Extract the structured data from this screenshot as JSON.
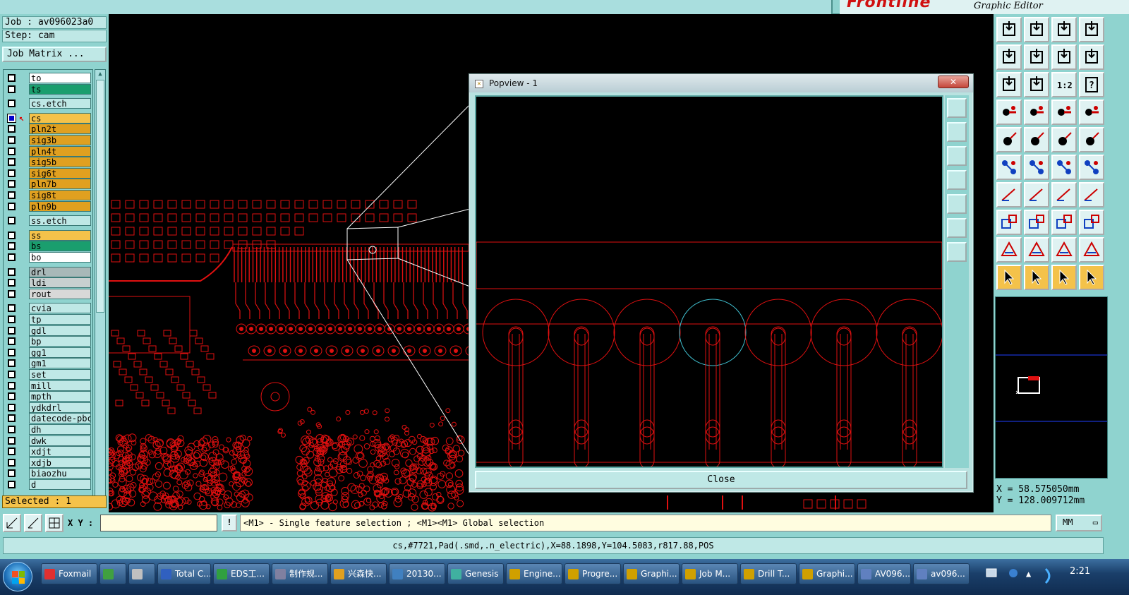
{
  "brand": {
    "logo": "Frontline",
    "caption": "Graphic Editor"
  },
  "job": {
    "job_line": "Job : av096023a0",
    "step_line": "Step: cam",
    "matrix_button": "Job Matrix ..."
  },
  "layers": [
    {
      "name": "to",
      "color": "#ffffff",
      "group": 0
    },
    {
      "name": "ts",
      "color": "#1a9e6e",
      "group": 0
    },
    {
      "name": "cs.etch",
      "color": "#bfe8e6",
      "group": 1
    },
    {
      "name": "cs",
      "color": "#f4c24a",
      "group": 2,
      "active": true
    },
    {
      "name": "pln2t",
      "color": "#e0a020",
      "group": 2
    },
    {
      "name": "sig3b",
      "color": "#e0a020",
      "group": 2
    },
    {
      "name": "pln4t",
      "color": "#e0a020",
      "group": 2
    },
    {
      "name": "sig5b",
      "color": "#e0a020",
      "group": 2
    },
    {
      "name": "sig6t",
      "color": "#e0a020",
      "group": 2
    },
    {
      "name": "pln7b",
      "color": "#e0a020",
      "group": 2
    },
    {
      "name": "sig8t",
      "color": "#e0a020",
      "group": 2
    },
    {
      "name": "pln9b",
      "color": "#e0a020",
      "group": 2
    },
    {
      "name": "ss.etch",
      "color": "#bfe8e6",
      "group": 3
    },
    {
      "name": "ss",
      "color": "#f4c24a",
      "group": 4
    },
    {
      "name": "bs",
      "color": "#1a9e6e",
      "group": 4
    },
    {
      "name": "bo",
      "color": "#ffffff",
      "group": 4
    },
    {
      "name": "drl",
      "color": "#a8b8b8",
      "group": 5
    },
    {
      "name": "ldi",
      "color": "#c8d0d0",
      "group": 5
    },
    {
      "name": "rout",
      "color": "#d8d8d8",
      "group": 5
    },
    {
      "name": "cvia",
      "color": "#bfe8e6",
      "group": 6
    },
    {
      "name": "tp",
      "color": "#bfe8e6",
      "group": 6
    },
    {
      "name": "gdl",
      "color": "#bfe8e6",
      "group": 6
    },
    {
      "name": "bp",
      "color": "#bfe8e6",
      "group": 6
    },
    {
      "name": "gg1",
      "color": "#bfe8e6",
      "group": 6
    },
    {
      "name": "gm1",
      "color": "#bfe8e6",
      "group": 6
    },
    {
      "name": "set",
      "color": "#bfe8e6",
      "group": 6
    },
    {
      "name": "mill",
      "color": "#bfe8e6",
      "group": 6
    },
    {
      "name": "mpth",
      "color": "#bfe8e6",
      "group": 6
    },
    {
      "name": "ydkdrl",
      "color": "#bfe8e6",
      "group": 6
    },
    {
      "name": "datecode-pbc",
      "color": "#bfe8e6",
      "group": 6
    },
    {
      "name": "dh",
      "color": "#bfe8e6",
      "group": 6
    },
    {
      "name": "dwk",
      "color": "#bfe8e6",
      "group": 6
    },
    {
      "name": "xdjt",
      "color": "#bfe8e6",
      "group": 6
    },
    {
      "name": "xdjb",
      "color": "#bfe8e6",
      "group": 6
    },
    {
      "name": "biaozhu",
      "color": "#bfe8e6",
      "group": 6
    },
    {
      "name": "d",
      "color": "#bfe8e6",
      "group": 6
    }
  ],
  "selected": "Selected : 1",
  "popview": {
    "title": "Popview - 1",
    "close_x": "✕",
    "close_button": "Close"
  },
  "coords": {
    "x": "X  =  58.575050mm",
    "y": "Y  = 128.009712mm"
  },
  "command": {
    "xy_label": "X Y :",
    "xy_value": "",
    "bang": "!",
    "hint": "<M1> - Single feature selection ; <M1><M1> Global selection",
    "units": "MM"
  },
  "status": "cs,#7721,Pad(.smd,.n_electric),X=88.1898,Y=104.5083,r817.88,POS",
  "taskbar": {
    "items": [
      {
        "label": "Foxmail",
        "icon_color": "#e03030"
      },
      {
        "label": "",
        "icon_color": "#40a040"
      },
      {
        "label": "",
        "icon_color": "#c0c0c0"
      },
      {
        "label": "Total C...",
        "icon_color": "#3060c0"
      },
      {
        "label": "EDS工...",
        "icon_color": "#30a040"
      },
      {
        "label": "制作规...",
        "icon_color": "#8080a0"
      },
      {
        "label": "兴森快...",
        "icon_color": "#e0a020"
      },
      {
        "label": "20130...",
        "icon_color": "#4080c0"
      },
      {
        "label": "Genesis",
        "icon_color": "#40b0a0"
      },
      {
        "label": "Engine...",
        "icon_color": "#d0a000"
      },
      {
        "label": "Progre...",
        "icon_color": "#d0a000"
      },
      {
        "label": "Graphi...",
        "icon_color": "#d0a000"
      },
      {
        "label": "Job M...",
        "icon_color": "#d0a000"
      },
      {
        "label": "Drill T...",
        "icon_color": "#d0a000"
      },
      {
        "label": "Graphi...",
        "icon_color": "#d0a000"
      },
      {
        "label": "AV096...",
        "icon_color": "#6080c0"
      },
      {
        "label": "av096...",
        "icon_color": "#6080c0"
      }
    ],
    "clock": "2:21"
  }
}
